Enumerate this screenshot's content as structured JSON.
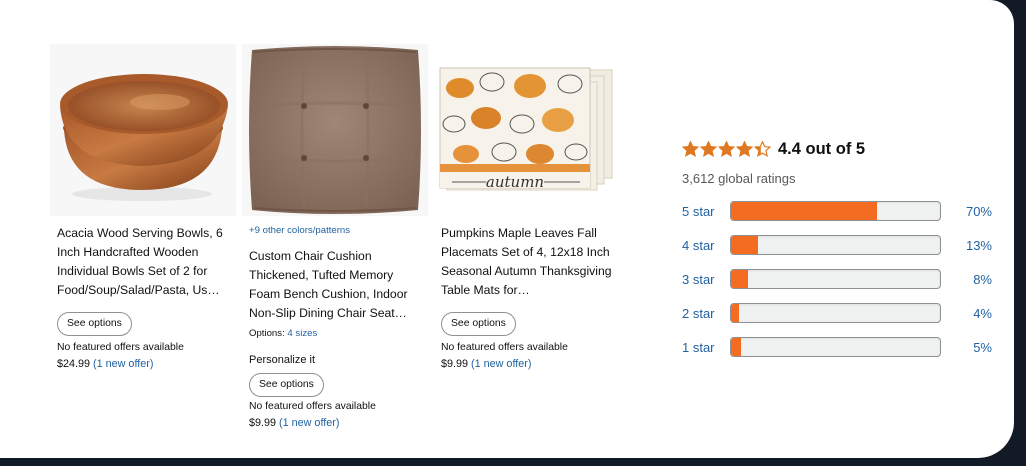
{
  "products": [
    {
      "image": "wood-bowls-image",
      "title": "Acacia Wood Serving Bowls, 6 Inch Handcrafted Wooden Individual Bowls Set of 2 for Food/Soup/Salad/Pasta, Us…",
      "button": "See options",
      "offers": "No featured offers available",
      "price": "$24.99",
      "offer_link": "(1 new offer)"
    },
    {
      "image": "chair-cushion-image",
      "colors_link": "+9 other colors/patterns",
      "title": "Custom Chair Cushion Thickened, Tufted Memory Foam Bench Cushion, Indoor Non-Slip Dining Chair Seat…",
      "options_label": "Options:",
      "options_value": "4 sizes",
      "personalize": "Personalize it",
      "button": "See options",
      "offers": "No featured offers available",
      "price": "$9.99",
      "offer_link": "(1 new offer)"
    },
    {
      "image": "pumpkin-placemats-image",
      "title": "Pumpkins Maple Leaves Fall Placemats Set of 4, 12x18 Inch Seasonal Autumn Thanksgiving Table Mats for…",
      "image_text": "autumn",
      "button": "See options",
      "offers": "No featured offers available",
      "price": "$9.99",
      "offer_link": "(1 new offer)"
    }
  ],
  "ratings": {
    "average_text": "4.4 out of 5",
    "average_value": 4.4,
    "global_text": "3,612 global ratings",
    "star_color": "#de7921",
    "bar_color": "#f36c21",
    "rows": [
      {
        "label": "5 star",
        "percent_text": "70%",
        "percent": 70
      },
      {
        "label": "4 star",
        "percent_text": "13%",
        "percent": 13
      },
      {
        "label": "3 star",
        "percent_text": "8%",
        "percent": 8
      },
      {
        "label": "2 star",
        "percent_text": "4%",
        "percent": 4
      },
      {
        "label": "1 star",
        "percent_text": "5%",
        "percent": 5
      }
    ]
  }
}
